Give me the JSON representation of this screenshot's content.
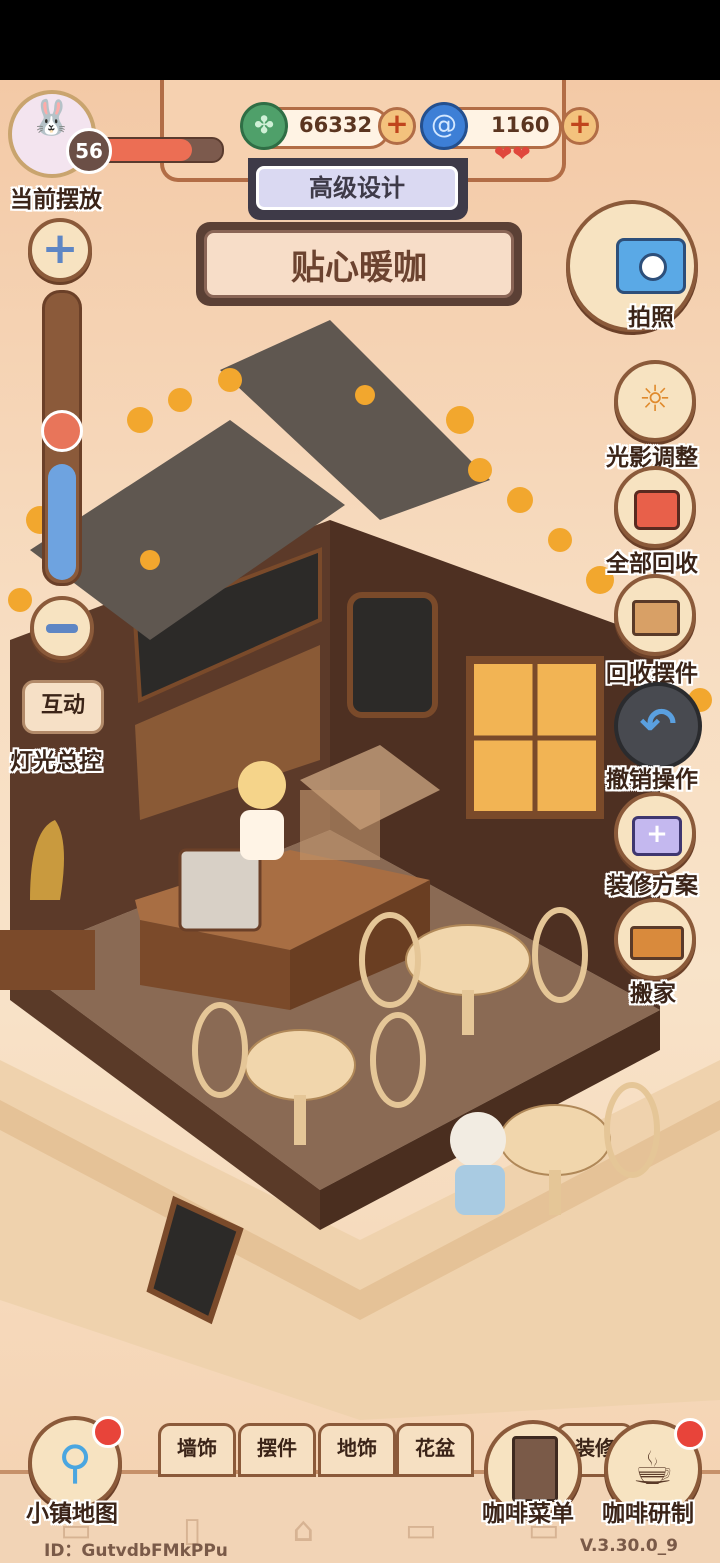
{
  "player": {
    "level": "56",
    "placement_label": "当前摆放"
  },
  "currency": {
    "leaf_amount": "66332",
    "gem_amount": "1160"
  },
  "banner": {
    "upper_label": "高级设计",
    "shop_name": "贴心暖咖"
  },
  "left_controls": {
    "interact_label": "互动",
    "light_label": "灯光总控",
    "light_level": 0.3
  },
  "right_menu": [
    {
      "label": "拍照",
      "icon": "camera-icon"
    },
    {
      "label": "光影调整",
      "icon": "sun-moon-icon"
    },
    {
      "label": "全部回收",
      "icon": "recycle-all-icon"
    },
    {
      "label": "回收摆件",
      "icon": "recycle-item-icon"
    },
    {
      "label": "撤销操作",
      "icon": "undo-icon"
    },
    {
      "label": "装修方案",
      "icon": "folder-plus-icon"
    },
    {
      "label": "搬家",
      "icon": "truck-icon"
    }
  ],
  "bottom_bar": {
    "map_label": "小镇地图",
    "tabs": [
      "墙饰",
      "摆件",
      "地饰",
      "花盆",
      "装修"
    ],
    "menu_label": "咖啡菜单",
    "research_label": "咖啡研制",
    "player_id": "ID：GutvdbFMkPPu",
    "version": "V.3.30.0_9"
  },
  "colors": {
    "accent": "#b26d46",
    "wood": "#6b4028",
    "badge": "#e8443a"
  }
}
